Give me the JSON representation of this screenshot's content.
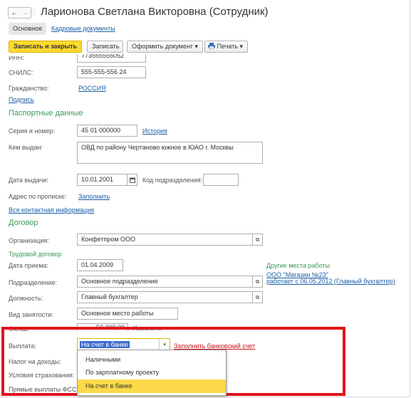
{
  "window": {
    "title": "Ларионова Светлана Викторовна (Сотрудник)",
    "back_icon": "←",
    "forward_icon": "→",
    "star_icon": "☆"
  },
  "tabs": {
    "main": "Основное",
    "hr_docs": "Кадровые документы"
  },
  "toolbar": {
    "save_close": "Записать и закрыть",
    "save": "Записать",
    "issue_doc": "Оформить документ ▾",
    "print": "Печать ▾"
  },
  "personal": {
    "inn_label": "ИНН:",
    "inn_value": "773555555052",
    "snils_label": "СНИЛС:",
    "snils_value": "555-555-556 24",
    "citizenship_label": "Гражданство:",
    "citizenship_value": "РОССИЯ",
    "signature_link": "Подпись"
  },
  "passport": {
    "header": "Паспортные данные",
    "series_label": "Серия и номер:",
    "series_value": "45 01 000000",
    "history_link": "История",
    "issued_by_label": "Кем выдан:",
    "issued_by_value": "ОВД по району Чертаново южное в ЮАО г. Москвы",
    "issue_date_label": "Дата выдачи:",
    "issue_date_value": "10.01.2001",
    "division_code_label": "Код подразделения:",
    "division_code_value": "",
    "address_label": "Адрес по прописке:",
    "address_link": "Заполнить",
    "all_contacts_link": "Вся контактная информация"
  },
  "contract": {
    "header": "Договор",
    "org_label": "Организация:",
    "org_value": "Конфетпром ООО",
    "labor_contract_label": "Трудовой договор",
    "hire_date_label": "Дата приема:",
    "hire_date_value": "01.04.2009",
    "other_jobs_label": "Другие места работы",
    "other_job_line1": "ООО \"Магазин №23\"",
    "other_job_line2": "работает с 06.05.2012 (Главный бухгалтер)",
    "department_label": "Подразделение:",
    "department_value": "Основное подразделение",
    "position_label": "Должность:",
    "position_value": "Главный бухгалтер",
    "employment_label": "Вид занятости:",
    "employment_value": "Основное место работы",
    "salary_label": "Оклад:",
    "salary_value": "50 000,00",
    "change_link": "Изменить"
  },
  "payment": {
    "label": "Выплата:",
    "value": "На счет в банке",
    "fill_bank_link": "Заполнить банковский счет",
    "tax_label": "Налог на доходы:",
    "insurance_label": "Условия страхования:",
    "fss_label": "Прямые выплаты ФСС:",
    "options": [
      "Наличными",
      "По зарплатному проекту",
      "На счет в банке"
    ],
    "selected_index": 2
  },
  "colors": {
    "accent_yellow": "#ffd92e",
    "section_green": "#3a9a57",
    "link_blue": "#1a5fa8",
    "highlight_red": "#e4141b"
  }
}
